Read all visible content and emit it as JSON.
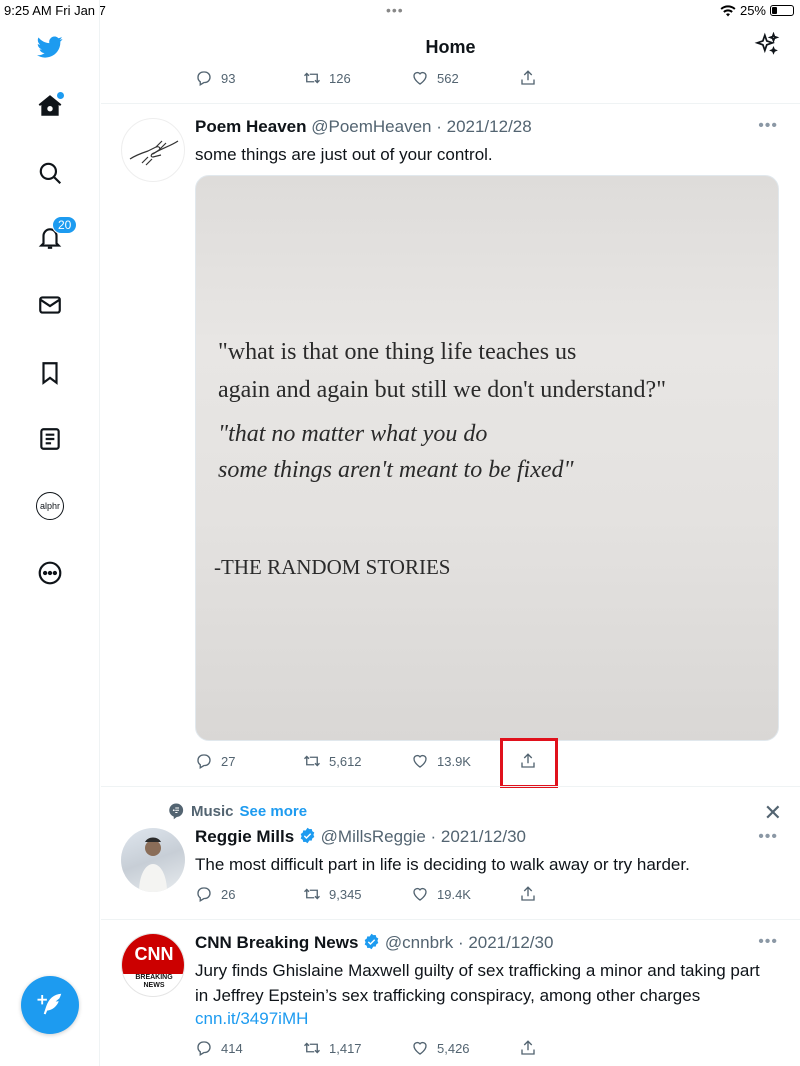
{
  "status_bar": {
    "time": "9:25 AM  Fri Jan 7",
    "battery": "25%"
  },
  "sidebar": {
    "notification_count": "20",
    "account_label": "alphr"
  },
  "header": {
    "title": "Home"
  },
  "top_tweet": {
    "replies": "93",
    "retweets": "126",
    "likes": "562"
  },
  "tweets": [
    {
      "name": "Poem Heaven",
      "handle": "@PoemHeaven",
      "date": "· 2021/12/28",
      "text": "some things are just out of your control.",
      "image_lines": [
        "\"what is that one thing life teaches us",
        "again and again but still we don't understand?\"",
        "\"that no matter what you do",
        "some things aren't meant to be fixed\"",
        "-THE RANDOM STORIES"
      ],
      "replies": "27",
      "retweets": "5,612",
      "likes": "13.9K"
    },
    {
      "context": "Music",
      "context_link": "See more",
      "name": "Reggie Mills",
      "handle": "@MillsReggie",
      "date": "· 2021/12/30",
      "text": "The most difficult part in life is deciding to walk away or try harder.",
      "replies": "26",
      "retweets": "9,345",
      "likes": "19.4K"
    },
    {
      "name": "CNN Breaking News",
      "handle": "@cnnbrk",
      "date": "· 2021/12/30",
      "text": "Jury finds Ghislaine Maxwell guilty of sex trafficking a minor and taking part in Jeffrey Epstein’s sex trafficking conspiracy, among other charges",
      "link": "cnn.it/3497iMH",
      "avatar_logo": "CNN",
      "avatar_sub": "BREAKING NEWS",
      "replies": "414",
      "retweets": "1,417",
      "likes": "5,426"
    }
  ],
  "colors": {
    "accent": "#1d9bf0",
    "highlight": "#e0111c",
    "secondary_text": "#536471"
  }
}
